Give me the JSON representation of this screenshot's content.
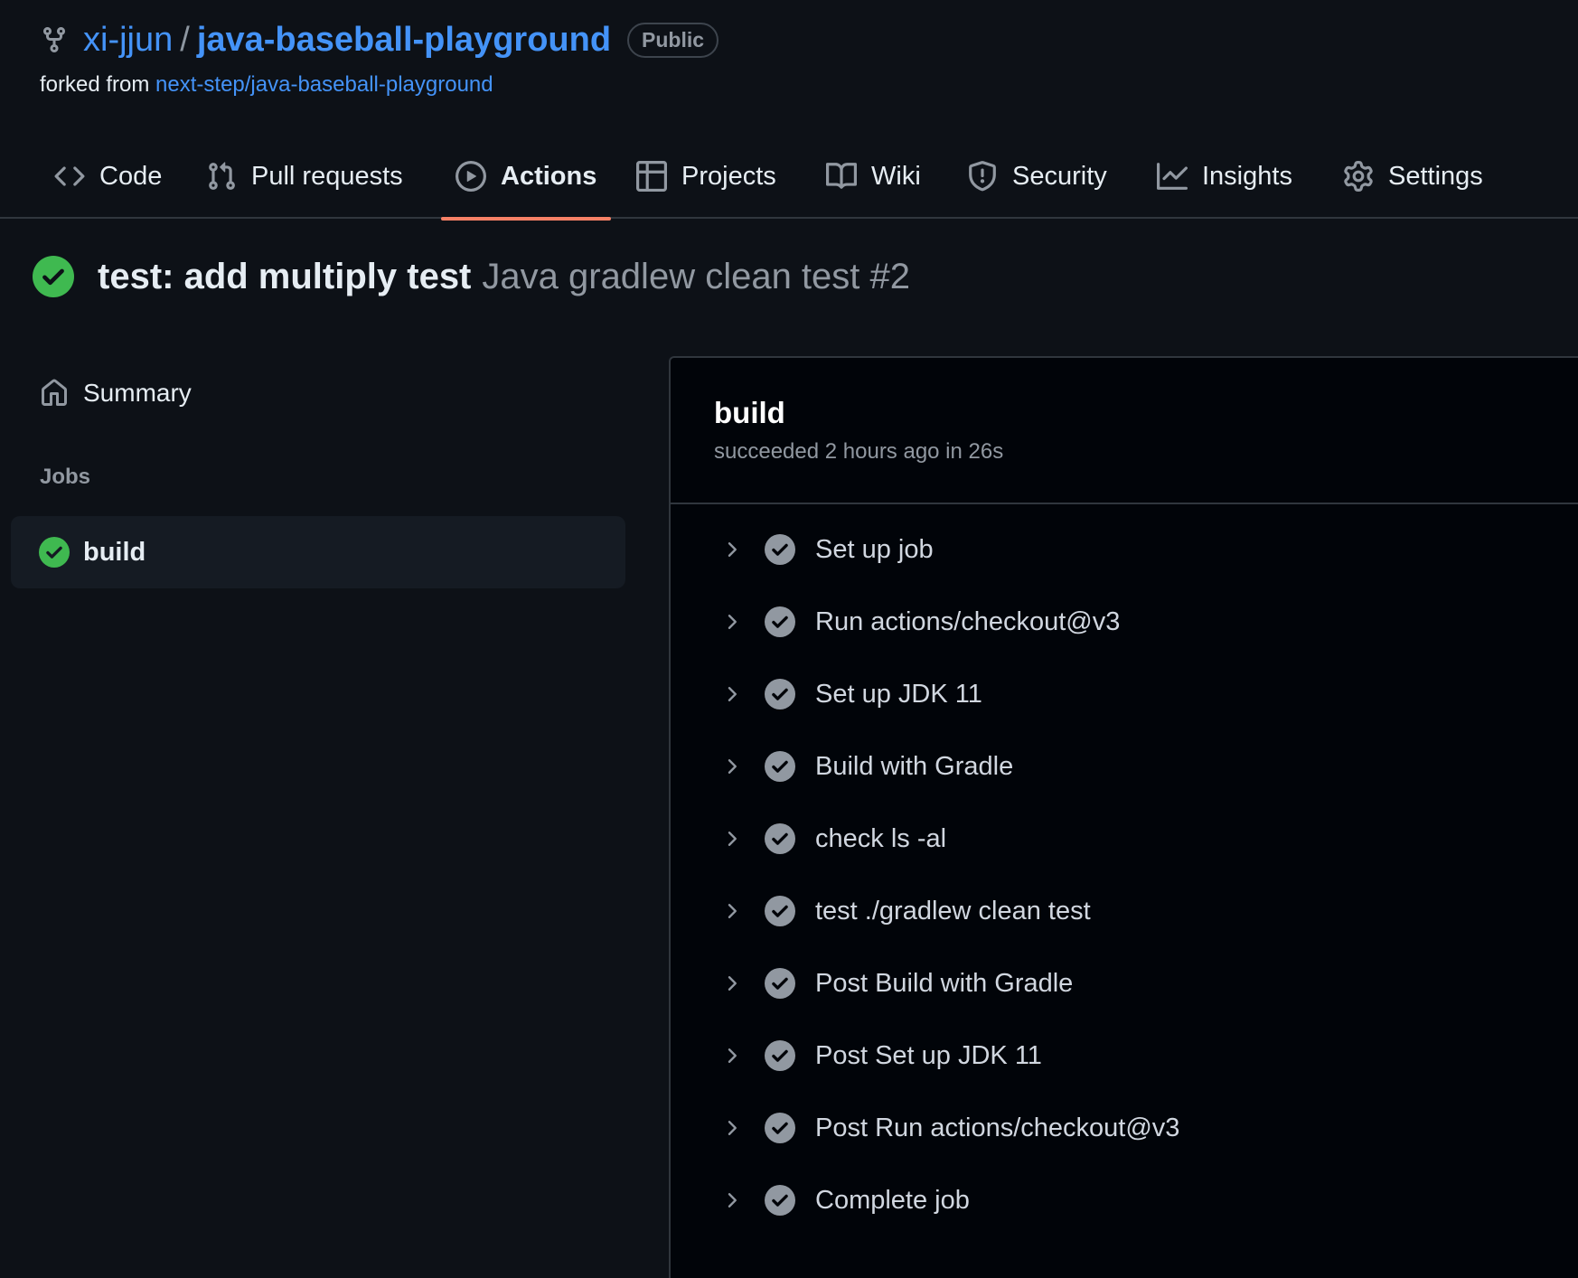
{
  "repo": {
    "owner": "xi-jjun",
    "separator": "/",
    "name": "java-baseball-playground",
    "visibility": "Public",
    "forked_prefix": "forked from",
    "forked_source": "next-step/java-baseball-playground"
  },
  "tabs": [
    {
      "label": "Code",
      "icon": "code-icon"
    },
    {
      "label": "Pull requests",
      "icon": "git-pull-request-icon"
    },
    {
      "label": "Actions",
      "icon": "play-icon",
      "active": true
    },
    {
      "label": "Projects",
      "icon": "table-icon"
    },
    {
      "label": "Wiki",
      "icon": "book-icon"
    },
    {
      "label": "Security",
      "icon": "shield-icon"
    },
    {
      "label": "Insights",
      "icon": "graph-icon"
    },
    {
      "label": "Settings",
      "icon": "gear-icon"
    }
  ],
  "run": {
    "commit_message": "test: add multiply test",
    "workflow": "Java gradlew clean test #2",
    "status": "success"
  },
  "sidebar": {
    "summary_label": "Summary",
    "jobs_heading": "Jobs",
    "jobs": [
      {
        "label": "build",
        "status": "success"
      }
    ]
  },
  "job": {
    "title": "build",
    "subtitle": "succeeded 2 hours ago in 26s",
    "steps": [
      "Set up job",
      "Run actions/checkout@v3",
      "Set up JDK 11",
      "Build with Gradle",
      "check ls -al",
      "test ./gradlew clean test",
      "Post Build with Gradle",
      "Post Set up JDK 11",
      "Post Run actions/checkout@v3",
      "Complete job"
    ]
  },
  "colors": {
    "background": "#0d1117",
    "panel": "#010409",
    "link": "#4493f8",
    "success": "#3fb950",
    "step_check": "#9198a1",
    "active_tab_underline": "#f78166"
  }
}
